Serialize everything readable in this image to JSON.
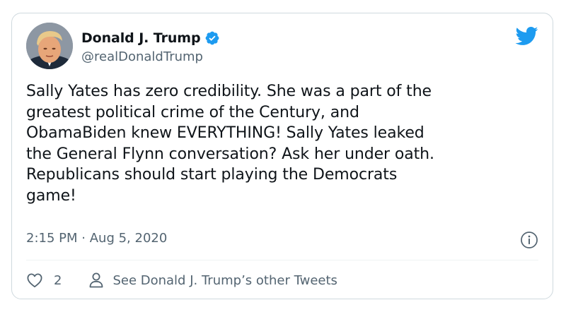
{
  "author": {
    "display_name": "Donald J. Trump",
    "handle": "@realDonaldTrump",
    "verified": true
  },
  "tweet": {
    "text": "Sally Yates has zero credibility. She was a part of the\ngreatest political crime of the Century, and\nObamaBiden knew EVERYTHING! Sally Yates leaked\nthe General Flynn conversation? Ask her under oath.\nRepublicans should start playing the Democrats\ngame!",
    "time": "2:15 PM",
    "separator": "·",
    "date": "Aug 5, 2020"
  },
  "actions": {
    "like_count": "2",
    "profile_link_label": "See Donald J. Trump’s other Tweets"
  },
  "icons": {
    "brand": "twitter-bird-icon",
    "verified": "verified-badge-icon",
    "info": "info-icon",
    "like": "heart-icon",
    "profile": "user-icon"
  },
  "colors": {
    "brand": "#1d9bf0",
    "text_primary": "#0f1419",
    "text_secondary": "#536471",
    "border": "#cfd9de"
  }
}
